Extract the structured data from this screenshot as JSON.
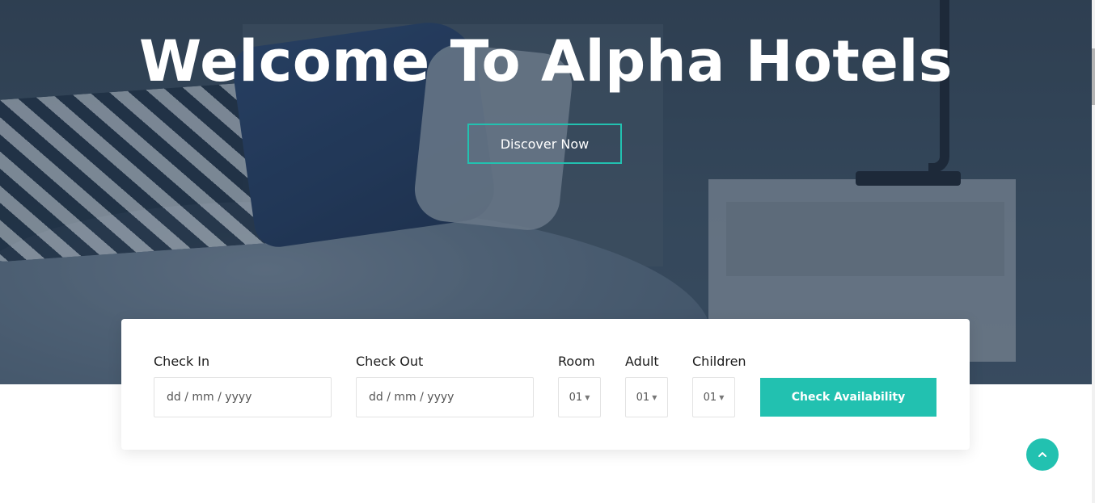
{
  "hero": {
    "title": "Welcome To Alpha Hotels",
    "discover_label": "Discover Now"
  },
  "booking": {
    "check_in": {
      "label": "Check In",
      "value": "dd / mm / yyyy"
    },
    "check_out": {
      "label": "Check Out",
      "value": "dd / mm / yyyy"
    },
    "room": {
      "label": "Room",
      "value": "01"
    },
    "adult": {
      "label": "Adult",
      "value": "01"
    },
    "children": {
      "label": "Children",
      "value": "01"
    },
    "submit_label": "Check Availability"
  },
  "icons": {
    "select_chevron": "chevron-down-icon",
    "scroll_top": "chevron-up-icon"
  },
  "colors": {
    "accent": "#22c1b0",
    "hero_overlay": "#1e3044"
  }
}
